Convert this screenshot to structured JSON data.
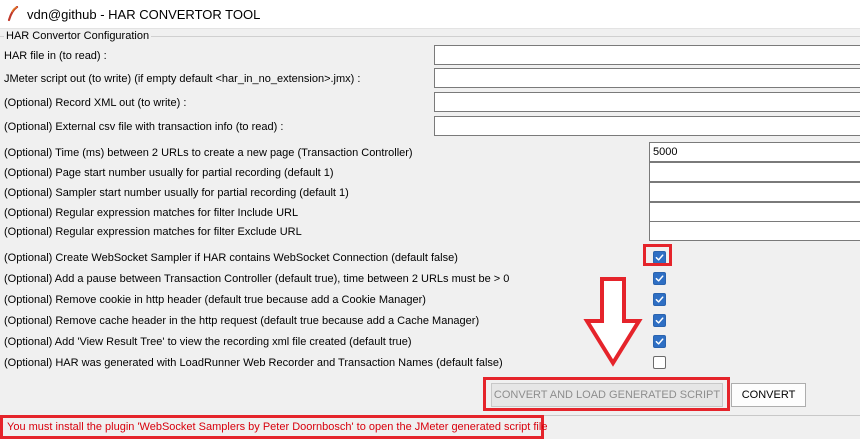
{
  "window": {
    "title": "vdn@github - HAR CONVERTOR TOOL",
    "icon": "feather-icon"
  },
  "config": {
    "group_title": "HAR Convertor Configuration",
    "har_file_in": {
      "label": "HAR file in (to read) :",
      "value": ""
    },
    "jmeter_script_out": {
      "label": "JMeter script out (to write) (if empty default <har_in_no_extension>.jmx) :",
      "value": ""
    },
    "record_xml_out": {
      "label": "(Optional) Record XML out (to write) :",
      "value": ""
    },
    "external_csv": {
      "label": "(Optional) External csv file with transaction info (to read) :",
      "value": ""
    },
    "time_between_urls": {
      "label": "(Optional) Time (ms) between 2 URLs to create a new page (Transaction Controller)",
      "value": "5000"
    },
    "page_start_number": {
      "label": "(Optional) Page start number usually for partial recording (default 1)",
      "value": ""
    },
    "sampler_start_number": {
      "label": "(Optional) Sampler start number usually for partial recording (default 1)",
      "value": ""
    },
    "filter_include_url": {
      "label": "(Optional) Regular expression matches for filter Include URL",
      "value": ""
    },
    "filter_exclude_url": {
      "label": "(Optional) Regular expression matches for filter Exclude URL",
      "value": ""
    }
  },
  "options": [
    {
      "label": "(Optional) Create WebSocket Sampler if HAR contains WebSocket Connection (default false)",
      "checked": true
    },
    {
      "label": "(Optional) Add a pause between Transaction Controller (default true), time between 2 URLs must be > 0",
      "checked": true
    },
    {
      "label": "(Optional) Remove cookie in http header (default true because add a Cookie Manager)",
      "checked": true
    },
    {
      "label": "(Optional) Remove cache header in the http request (default true because add a Cache Manager)",
      "checked": true
    },
    {
      "label": "(Optional) Add 'View Result Tree' to view the recording xml file created (default true)",
      "checked": true
    },
    {
      "label": "(Optional) HAR was generated with LoadRunner Web Recorder and Transaction Names (default false)",
      "checked": false
    }
  ],
  "buttons": {
    "convert_and_load": "CONVERT AND LOAD GENERATED SCRIPT",
    "convert": "CONVERT"
  },
  "status": {
    "message": "You must install the plugin 'WebSocket Samplers by Peter Doornbosch' to open the JMeter generated script file"
  },
  "colors": {
    "highlight": "#e5242b",
    "checkbox_checked": "#2e6fc4",
    "status_text": "#d8000c"
  }
}
